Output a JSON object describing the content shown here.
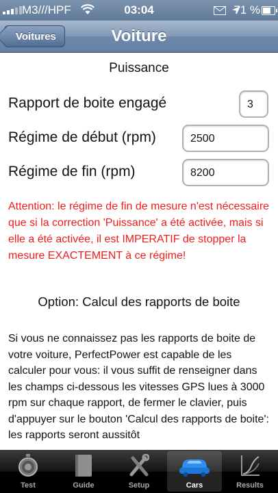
{
  "status_bar": {
    "carrier": "M3///HPF",
    "time": "03:04",
    "battery": "71 %"
  },
  "nav": {
    "back_label": "Voitures",
    "title": "Voiture"
  },
  "content": {
    "section_power": "Puissance",
    "rows": [
      {
        "label": "Rapport de boite engagé",
        "value": "3"
      },
      {
        "label": "Régime de début (rpm)",
        "value": "2500"
      },
      {
        "label": "Régime de fin (rpm)",
        "value": "8200"
      }
    ],
    "warning": "Attention: le régime de fin de mesure n'est nécessaire que si la correction 'Puissance' a été activée, mais si elle a été activée, il est IMPERATIF de stopper la mesure EXACTEMENT à ce régime!",
    "section_option": "Option: Calcul des rapports de boite",
    "option_text": "Si vous ne connaissez pas les rapports de boite de votre voiture, PerfectPower est capable de les calculer pour vous: il vous suffit de renseigner dans les champs ci-dessous les vitesses GPS lues à 3000 rpm sur chaque rapport, de fermer le clavier, puis d'appuyer sur le bouton 'Calcul des rapports de boite': les rapports seront aussitôt"
  },
  "tabs": [
    {
      "label": "Test",
      "icon": "stopwatch-icon"
    },
    {
      "label": "Guide",
      "icon": "book-icon"
    },
    {
      "label": "Setup",
      "icon": "tools-icon"
    },
    {
      "label": "Cars",
      "icon": "car-icon",
      "selected": true
    },
    {
      "label": "Results",
      "icon": "chart-icon"
    }
  ],
  "colors": {
    "navbar": "#6e89ab",
    "warning": "#ee1c1c",
    "selected_tab": "#1e90ff"
  }
}
